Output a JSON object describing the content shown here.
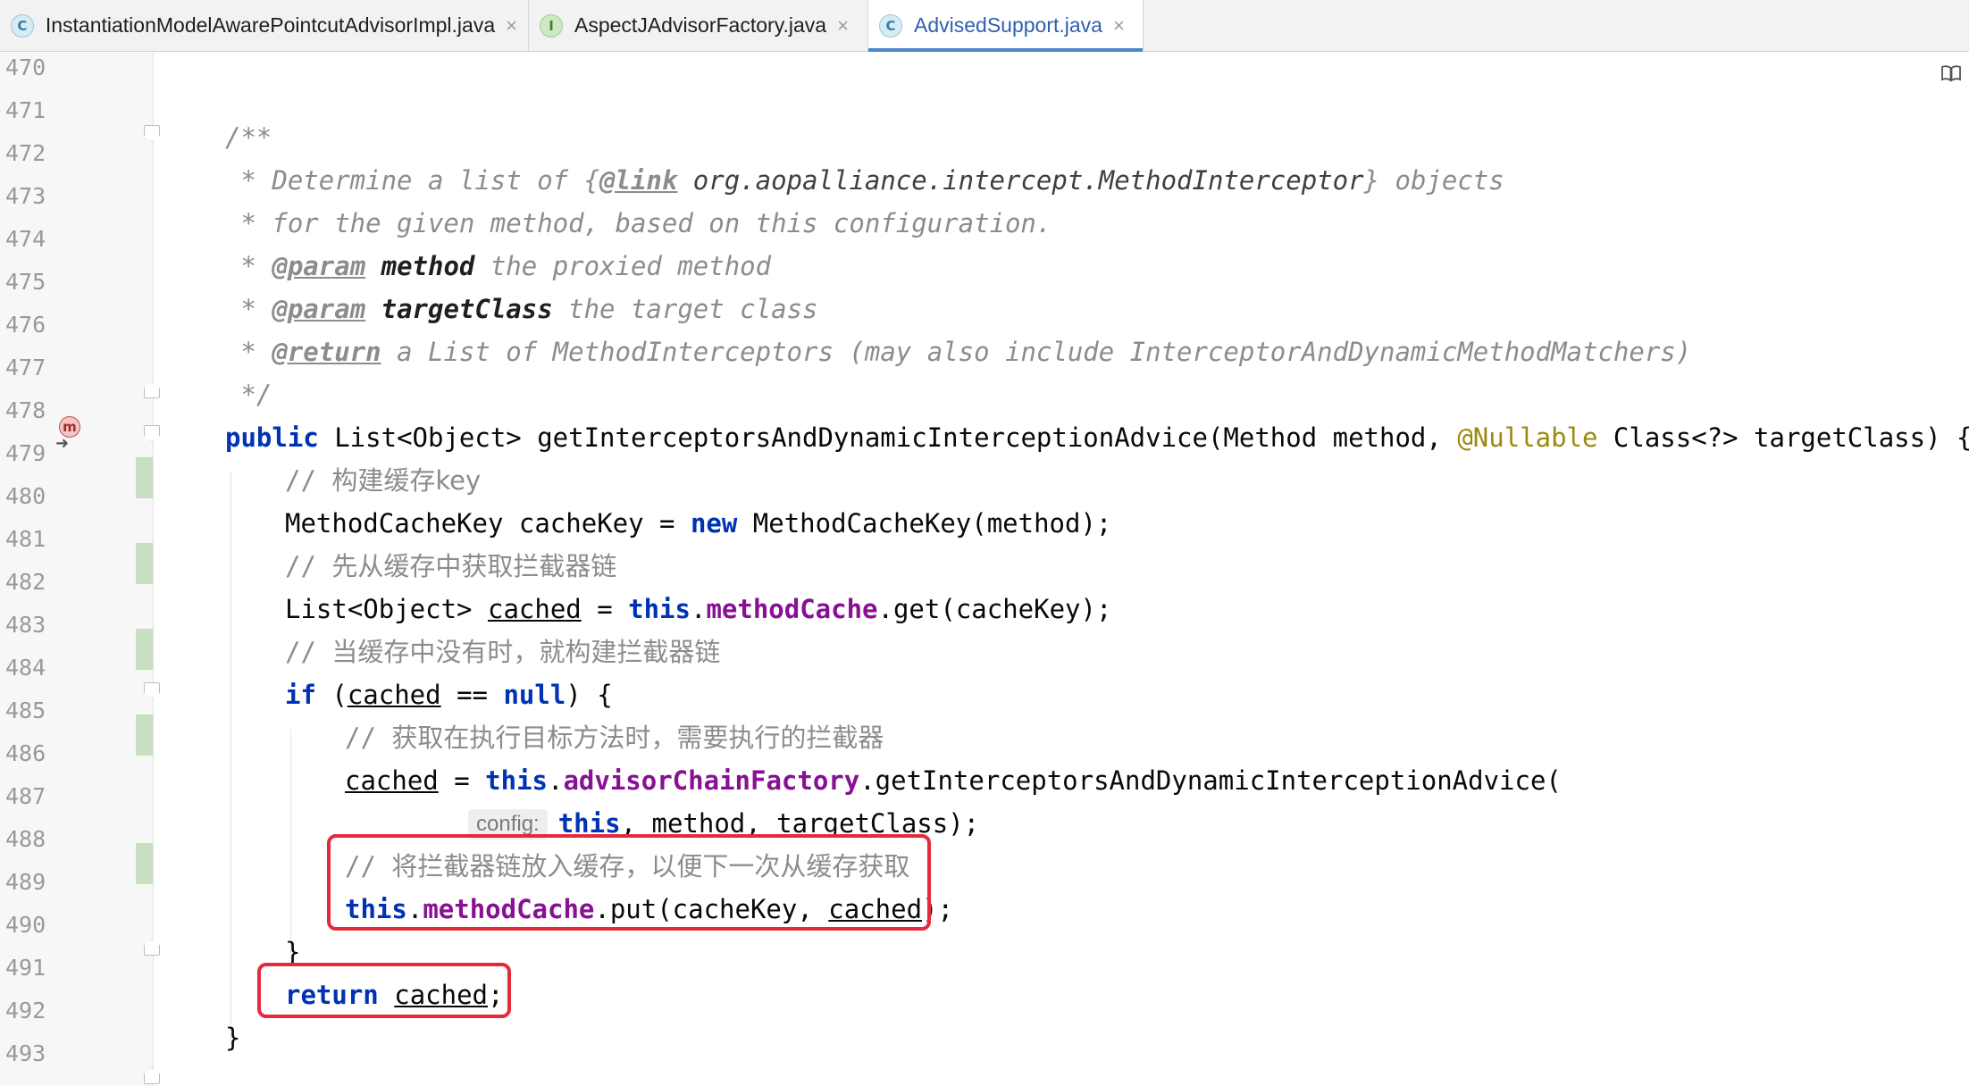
{
  "tabs": [
    {
      "label": "InstantiationModelAwarePointcutAdvisorImpl.java",
      "icon": "C",
      "kind": "class",
      "active": false
    },
    {
      "label": "AspectJAdvisorFactory.java",
      "icon": "I",
      "kind": "interface",
      "active": false
    },
    {
      "label": "AdvisedSupport.java",
      "icon": "C",
      "kind": "class",
      "active": true
    }
  ],
  "close_glyph": "×",
  "gutter": {
    "line_numbers": [
      "470",
      "471",
      "472",
      "473",
      "474",
      "475",
      "476",
      "477",
      "478",
      "479",
      "480",
      "481",
      "482",
      "483",
      "484",
      "485",
      "486",
      "487",
      "488",
      "489",
      "490",
      "491",
      "492",
      "493"
    ],
    "method_marker": "m"
  },
  "code": {
    "l471": "/**",
    "l472": {
      "a": " * Determine a list of {",
      "tag": "@link",
      "ref": " org.aopalliance.intercept.MethodInterceptor",
      "b": "} objects"
    },
    "l473": " * for the given method, based on this configuration.",
    "l474": {
      "a": " * ",
      "tag": "@param",
      "param": " method",
      "b": " the proxied method"
    },
    "l475": {
      "a": " * ",
      "tag": "@param",
      "param": " targetClass",
      "b": " the target class"
    },
    "l476": {
      "a": " * ",
      "tag": "@return",
      "b": " a List of MethodInterceptors (may also include InterceptorAndDynamicMethodMatchers)"
    },
    "l477": " */",
    "l478": {
      "kw": "public",
      "a": " List<Object> getInterceptorsAndDynamicInterceptionAdvice(Method method, ",
      "ann": "@Nullable",
      "b": " Class<?> targetClass) {"
    },
    "l479": {
      "slashes": "// ",
      "text": "构建缓存key"
    },
    "l480": {
      "a": "MethodCacheKey cacheKey = ",
      "kw": "new",
      "b": " MethodCacheKey(method);"
    },
    "l481": {
      "slashes": "// ",
      "text": "先从缓存中获取拦截器链"
    },
    "l482": {
      "a": "List<Object> ",
      "var": "cached",
      "b": " = ",
      "kw": "this",
      "dot": ".",
      "fld": "methodCache",
      "c": ".get(cacheKey);"
    },
    "l483": {
      "slashes": "// ",
      "text": "当缓存中没有时，就构建拦截器链"
    },
    "l484": {
      "kw": "if",
      "a": " (",
      "var": "cached",
      "b": " == ",
      "kw2": "null",
      "c": ") {"
    },
    "l485": {
      "slashes": "// ",
      "text": "获取在执行目标方法时，需要执行的拦截器"
    },
    "l486": {
      "var": "cached",
      "a": " = ",
      "kw": "this",
      "dot": ".",
      "fld": "advisorChainFactory",
      "b": ".getInterceptorsAndDynamicInterceptionAdvice("
    },
    "l487": {
      "hint": "config:",
      "kw": "this",
      "a": ", method, targetClass);"
    },
    "l488": {
      "slashes": "// ",
      "text": "将拦截器链放入缓存，以便下一次从缓存获取"
    },
    "l489": {
      "kw": "this",
      "dot": ".",
      "fld": "methodCache",
      "a": ".put(cacheKey, ",
      "var": "cached",
      "b": ");"
    },
    "l490": "}",
    "l491": {
      "kw": "return",
      "space": " ",
      "var": "cached",
      "a": ";"
    },
    "l492": "}"
  }
}
